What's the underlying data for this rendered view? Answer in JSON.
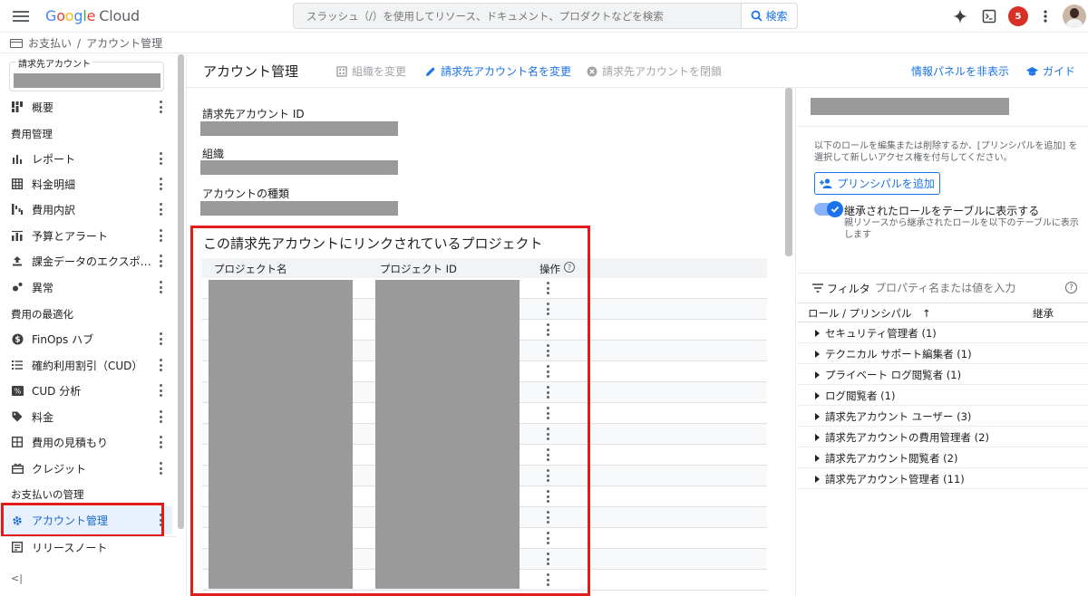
{
  "topbar": {
    "logo_text": "Google",
    "product": "Cloud",
    "search_placeholder": "スラッシュ（/）を使用してリソース、ドキュメント、プロダクトなどを検索",
    "search_button": "検索",
    "notification_count": "5"
  },
  "breadcrumb": {
    "items": [
      "お支払い",
      "/",
      "アカウント管理"
    ]
  },
  "sidebar": {
    "account_selector_label": "請求先アカウント",
    "overview": "概要",
    "section_cost": "費用管理",
    "reports": "レポート",
    "invoice": "料金明細",
    "breakdown": "費用内訳",
    "budget": "予算とアラート",
    "export": "課金データのエクスポ…",
    "anomaly": "異常",
    "section_optimize": "費用の最適化",
    "finops": "FinOps ハブ",
    "cud": "確約利用割引（CUD）",
    "cud_analysis": "CUD 分析",
    "pricing": "料金",
    "estimate": "費用の見積もり",
    "credits": "クレジット",
    "section_payment": "お支払いの管理",
    "account_mgmt": "アカウント管理",
    "release_notes": "リリースノート",
    "collapse_glyph": "<|"
  },
  "header": {
    "title": "アカウント管理",
    "change_org": "組織を変更",
    "rename": "請求先アカウント名を変更",
    "close_account": "請求先アカウントを閉鎖",
    "hide_panel": "情報パネルを非表示",
    "guide": "ガイド"
  },
  "details": {
    "account_id_label": "請求先アカウント ID",
    "org_label": "組織",
    "type_label": "アカウントの種類"
  },
  "projects": {
    "title": "この請求先アカウントにリンクされているプロジェクト",
    "col_name": "プロジェクト名",
    "col_id": "プロジェクト ID",
    "col_action": "操作",
    "row_count": 15
  },
  "info_panel": {
    "description": "以下のロールを編集または削除するか、[プリンシパルを追加] を選択して新しいアクセス権を付与してください。",
    "add_principal": "プリンシパルを追加",
    "toggle_label": "継承されたロールをテーブルに表示する",
    "toggle_on": true,
    "toggle_sub": "親リソースから継承されたロールを以下のテーブルに表示します",
    "filter_label": "フィルタ",
    "filter_placeholder": "プロパティ名または値を入力",
    "help_glyph": "?",
    "col_role": "ロール / プリンシパル",
    "sort_glyph": "↑",
    "col_inherit": "継承",
    "roles": [
      "セキュリティ管理者 (1)",
      "テクニカル サポート編集者 (1)",
      "プライベート ログ閲覧者 (1)",
      "ログ閲覧者 (1)",
      "請求先アカウント ユーザー (3)",
      "請求先アカウントの費用管理者 (2)",
      "請求先アカウント閲覧者 (2)",
      "請求先アカウント管理者 (11)"
    ]
  },
  "colors": {
    "accent": "#1a73e8",
    "highlight_border": "#e21b1b",
    "redaction": "#9a9a9a",
    "active_bg": "#e8f0fe"
  }
}
